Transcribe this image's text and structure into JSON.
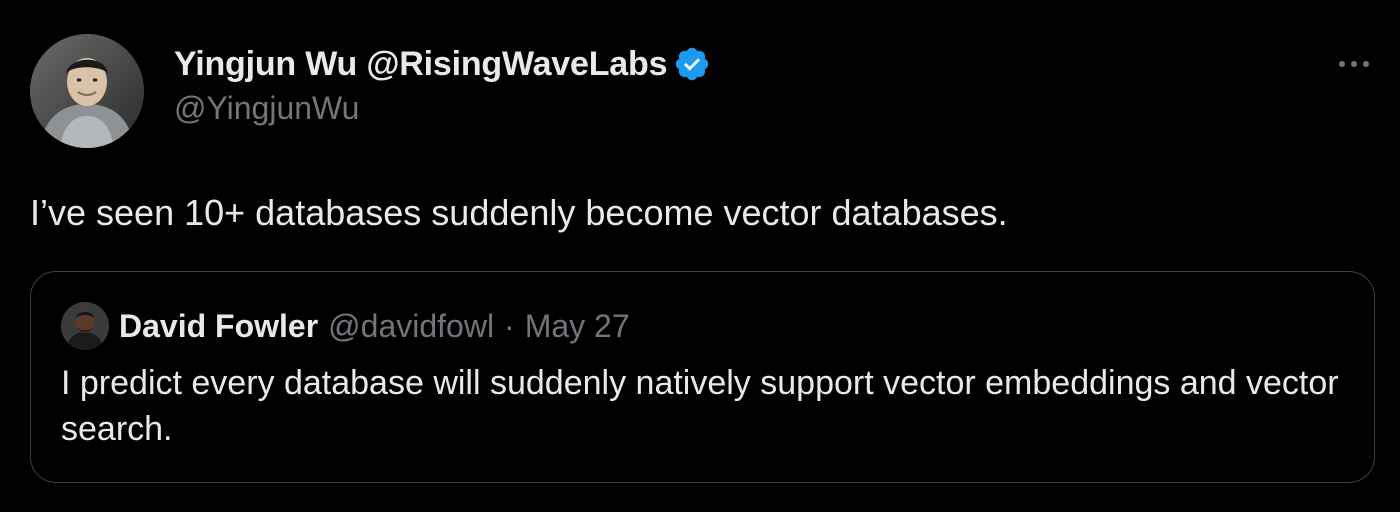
{
  "tweet": {
    "author": {
      "display_name": "Yingjun Wu @RisingWaveLabs",
      "handle": "@YingjunWu",
      "verified": true,
      "verified_color": "#1d9bf0"
    },
    "more_icon": "ellipsis-icon",
    "text": "I’ve seen 10+ databases suddenly become vector databases.",
    "quoted_tweet": {
      "author": {
        "display_name": "David Fowler",
        "handle": "@davidfowl"
      },
      "separator": "·",
      "date": "May 27",
      "text": "I predict every database will suddenly natively support vector embeddings and vector search."
    }
  },
  "colors": {
    "background": "#000000",
    "primary_text": "#e7e9ea",
    "secondary_text": "#71767b",
    "border": "#3c3f42"
  }
}
